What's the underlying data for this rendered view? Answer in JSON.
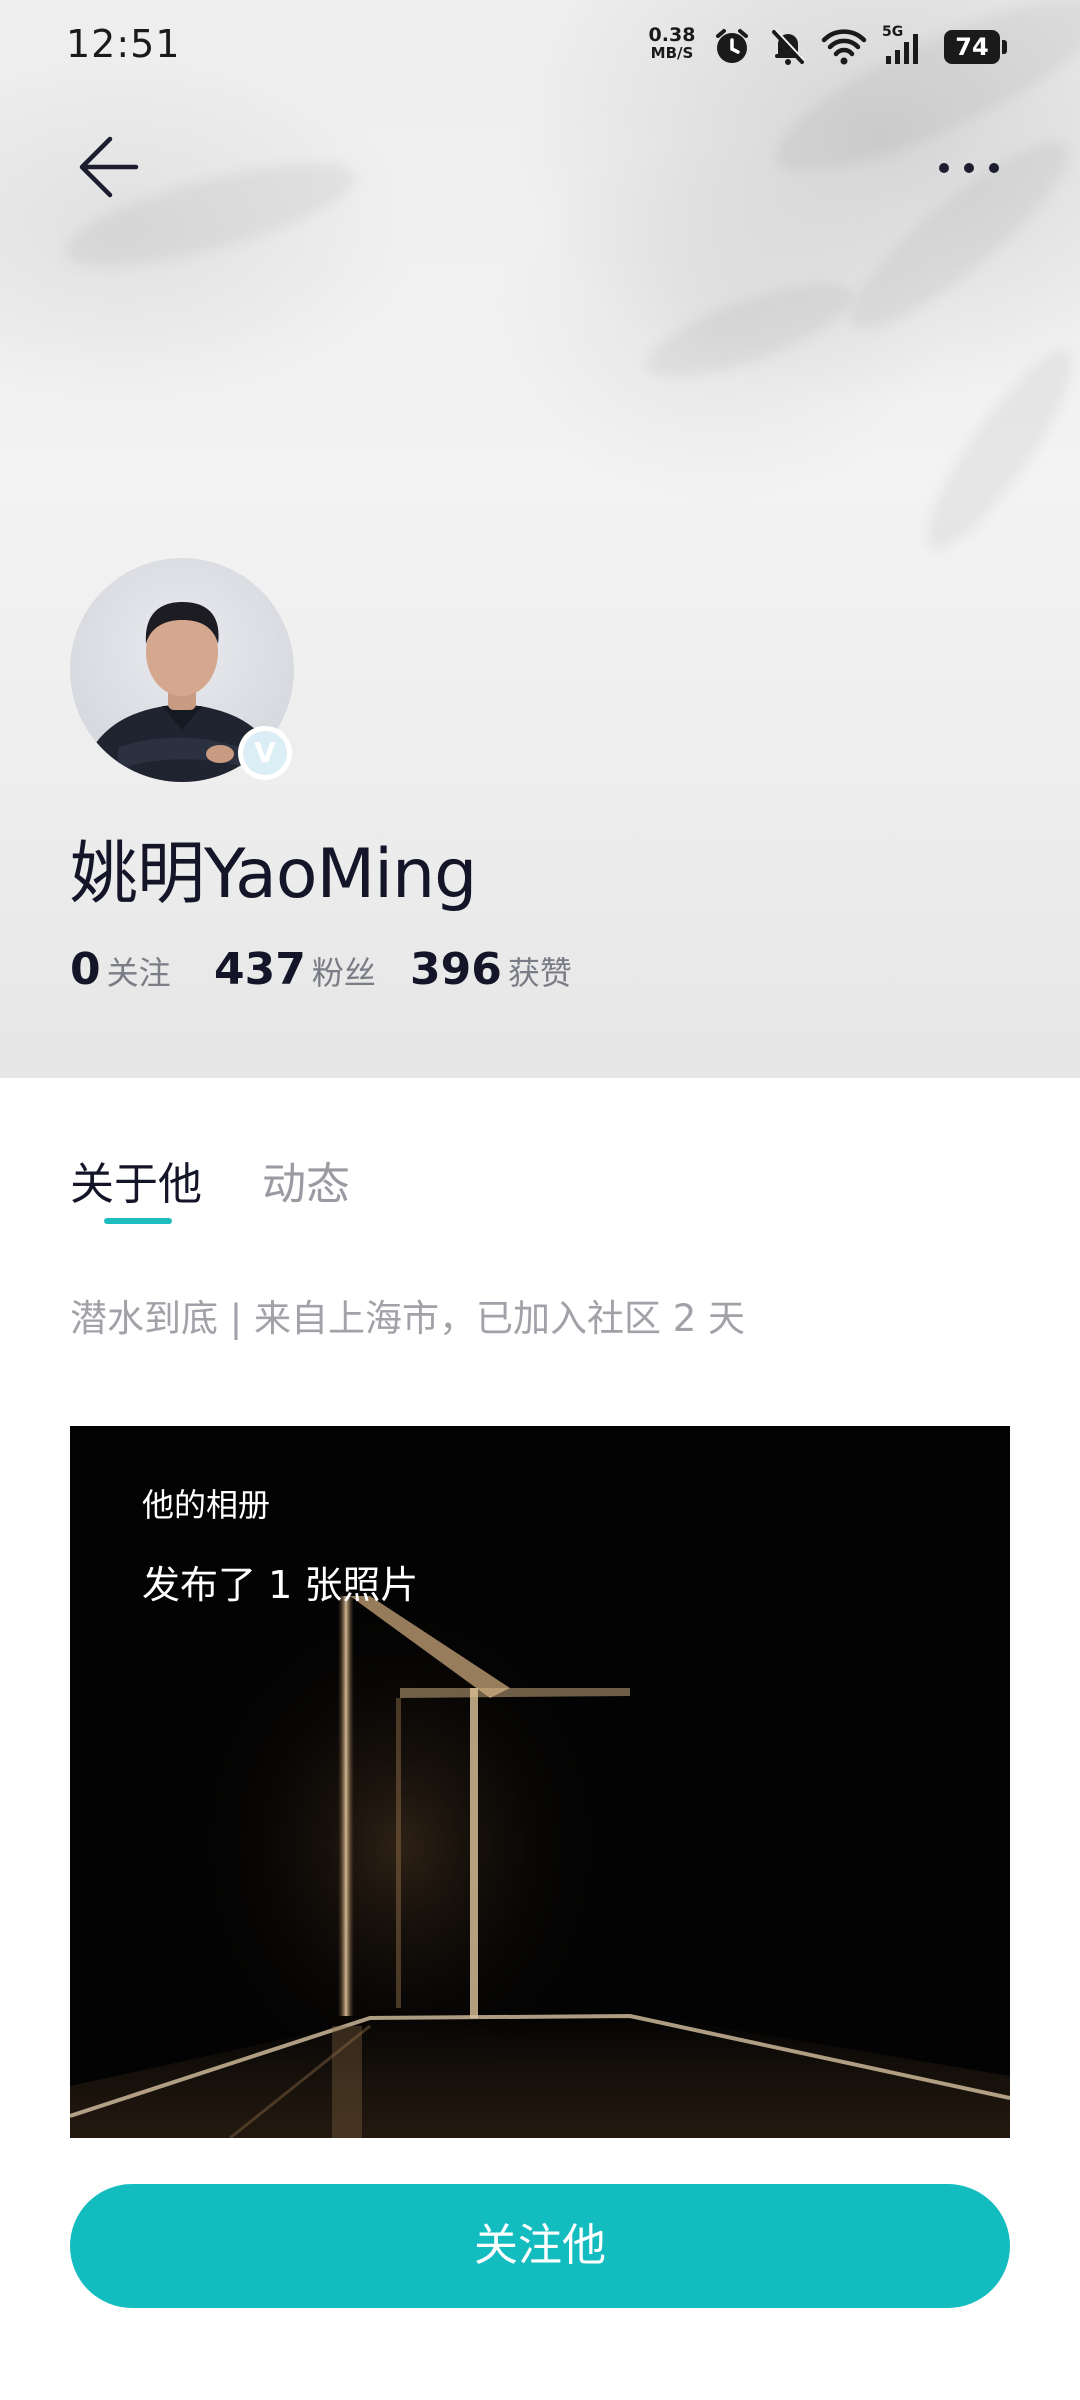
{
  "status_bar": {
    "time": "12:51",
    "net_speed_value": "0.38",
    "net_speed_unit": "MB/S",
    "signal_label": "5G",
    "battery": "74"
  },
  "profile": {
    "name": "姚明YaoMing",
    "verified": true,
    "stats": [
      {
        "value": "0",
        "label": "关注"
      },
      {
        "value": "437",
        "label": "粉丝"
      },
      {
        "value": "396",
        "label": "获赞"
      }
    ]
  },
  "tabs": [
    {
      "label": "关于他",
      "active": true
    },
    {
      "label": "动态",
      "active": false
    }
  ],
  "bio": "潜水到底 | 来自上海市，已加入社区 2 天",
  "album": {
    "title": "他的相册",
    "count_text": "发布了 1 张照片"
  },
  "follow_button": {
    "label": "关注他"
  },
  "colors": {
    "accent": "#13bcbf",
    "tab_indicator": "#1dbdbd",
    "name_text": "#141528"
  },
  "icons": [
    "back-arrow-icon",
    "more-icon",
    "alarm-icon",
    "mute-bell-icon",
    "wifi-icon",
    "signal-icon",
    "battery-icon",
    "verified-icon"
  ]
}
